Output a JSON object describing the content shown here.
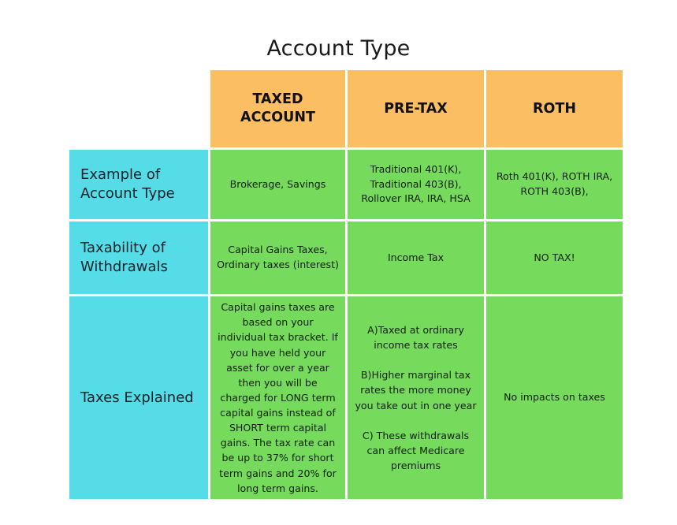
{
  "page": {
    "title": "Account Type",
    "background_color": "#ffffff"
  },
  "colors": {
    "header_orange": "#fcbe62",
    "row_label_cyan": "#56dce6",
    "cell_green": "#76da5c",
    "text_dark": "#111111"
  },
  "table": {
    "corner_label": "",
    "column_headers": [
      "TAXED\nACCOUNT",
      "PRE-TAX",
      "ROTH"
    ],
    "rows": [
      {
        "label": "Example of\nAccount Type",
        "cells": [
          "Brokerage, Savings",
          "Traditional 401(K),\nTraditional 403(B),\nRollover IRA, IRA, HSA",
          "Roth 401(K), ROTH IRA,\nROTH 403(B),"
        ]
      },
      {
        "label": "Taxability of\nWithdrawals",
        "cells": [
          "Capital Gains Taxes,\nOrdinary taxes (interest)",
          "Income Tax",
          "NO TAX!"
        ]
      },
      {
        "label": "Taxes Explained",
        "cells": [
          "Capital gains taxes are based on your individual tax bracket. If you have held your asset for over a year then you will be charged for LONG term capital gains instead of SHORT term capital gains. The tax rate can be up to 37% for short term gains and 20% for long term gains.",
          "A)Taxed at ordinary income   tax rates\n\nB)Higher marginal tax rates the more money you take   out in one year\n\nC) These withdrawals can affect Medicare premiums",
          "No impacts on taxes"
        ]
      }
    ]
  }
}
